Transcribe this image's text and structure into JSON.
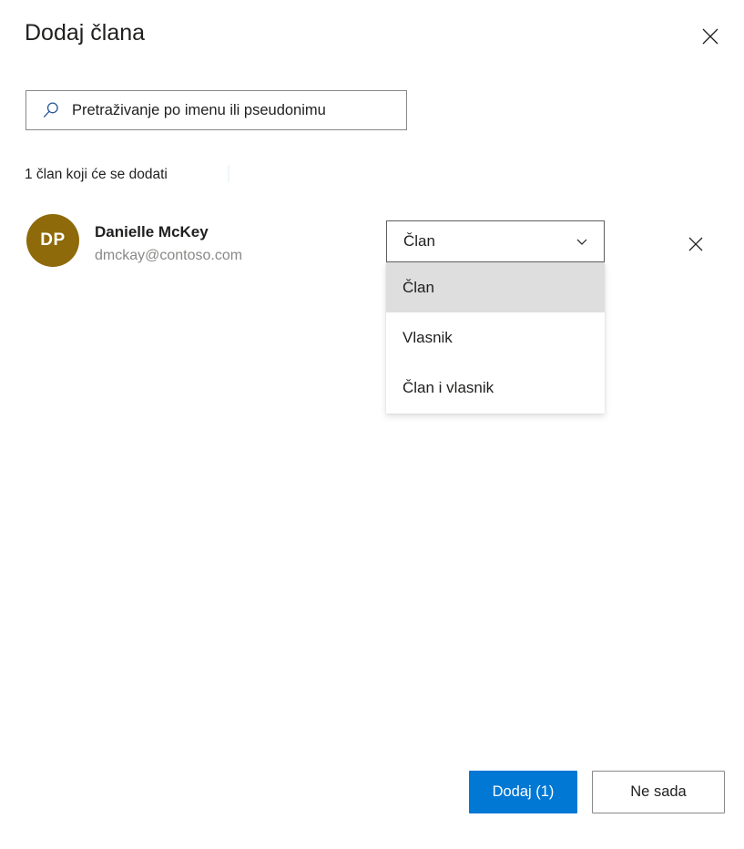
{
  "dialog": {
    "title": "Dodaj člana",
    "close_icon": "close-icon"
  },
  "search": {
    "icon": "search-icon",
    "placeholder": "Pretraživanje po imenu ili pseudonimu",
    "value": ""
  },
  "summary": {
    "count_text": "1 član koji će se dodati"
  },
  "member": {
    "avatar_initials": "DP",
    "avatar_color": "#8f6a0a",
    "name": "Danielle McKey",
    "email": "dmckay@contoso.com",
    "remove_icon": "close-icon"
  },
  "role_select": {
    "selected_value": "Član",
    "chevron_icon": "chevron-down-icon",
    "expanded": true,
    "options": [
      {
        "label": "Član",
        "selected": true
      },
      {
        "label": "Vlasnik",
        "selected": false
      },
      {
        "label": "Član i vlasnik",
        "selected": false
      }
    ]
  },
  "footer": {
    "primary_label": "Dodaj (1)",
    "secondary_label": "Ne sada",
    "primary_color": "#0078d4"
  }
}
